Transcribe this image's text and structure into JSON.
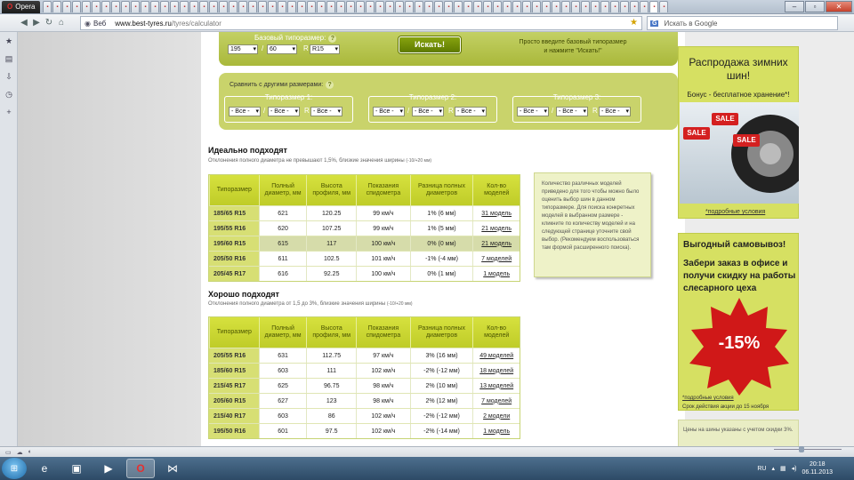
{
  "browser": {
    "menu_label": "Opera",
    "web_label": "Веб",
    "url_domain": "www.best-tyres.ru",
    "url_path": "/tyres/calculator",
    "search_placeholder": "Искать в Google",
    "search_engine": "G"
  },
  "form": {
    "base_size_label": "Базовый типоразмер:",
    "width": "195",
    "profile": "60",
    "r_label": "R",
    "radius": "R15",
    "search_button": "Искать!",
    "hint_line1": "Просто введите базовый типоразмер",
    "hint_line2": "и нажмите \"Искать!\"",
    "compare_label": "Сравнить с другими размерами:",
    "groups": [
      {
        "title": "Типоразмер 1:",
        "a": "- Все -",
        "b": "- Все -",
        "c": "- Все -"
      },
      {
        "title": "Типоразмер 2:",
        "a": "- Все -",
        "b": "- Все -",
        "c": "- Все -"
      },
      {
        "title": "Типоразмер 3:",
        "a": "- Все -",
        "b": "- Все -",
        "c": "- Все -"
      }
    ]
  },
  "ideal": {
    "title": "Идеально подходят",
    "subtitle": "Отклонения полного диаметра не превышают 1,5%, близкие значения ширины",
    "subtitle_small": "(-10/+20 мм)",
    "headers": [
      "Типоразмер",
      "Полный диаметр, мм",
      "Высота профиля, мм",
      "Показания спидометра",
      "Разница полных диаметров",
      "Кол-во моделей"
    ],
    "rows": [
      [
        "185/65 R15",
        "621",
        "120.25",
        "99 км/ч",
        "1% (6 мм)",
        "31 модель"
      ],
      [
        "195/55 R16",
        "620",
        "107.25",
        "99 км/ч",
        "1% (5 мм)",
        "21 модель"
      ],
      [
        "195/60 R15",
        "615",
        "117",
        "100 км/ч",
        "0% (0 мм)",
        "21 модель"
      ],
      [
        "205/50 R16",
        "611",
        "102.5",
        "101 км/ч",
        "-1% (-4 мм)",
        "7 моделей"
      ],
      [
        "205/45 R17",
        "616",
        "92.25",
        "100 км/ч",
        "0% (1 мм)",
        "1 модель"
      ]
    ]
  },
  "good": {
    "title": "Хорошо подходят",
    "subtitle": "Отклонения полного диаметра от 1,5 до 3%, близкие значения ширины",
    "subtitle_small": "(-10/+20 мм)",
    "headers": [
      "Типоразмер",
      "Полный диаметр, мм",
      "Высота профиля, мм",
      "Показания спидометра",
      "Разница полных диаметров",
      "Кол-во моделей"
    ],
    "rows": [
      [
        "205/55 R16",
        "631",
        "112.75",
        "97 км/ч",
        "3% (16 мм)",
        "49 моделей"
      ],
      [
        "185/60 R15",
        "603",
        "111",
        "102 км/ч",
        "-2% (-12 мм)",
        "18 моделей"
      ],
      [
        "215/45 R17",
        "625",
        "96.75",
        "98 км/ч",
        "2% (10 мм)",
        "13 моделей"
      ],
      [
        "205/60 R15",
        "627",
        "123",
        "98 км/ч",
        "2% (12 мм)",
        "7 моделей"
      ],
      [
        "215/40 R17",
        "603",
        "86",
        "102 км/ч",
        "-2% (-12 мм)",
        "2 модели"
      ],
      [
        "195/50 R16",
        "601",
        "97.5",
        "102 км/ч",
        "-2% (-14 мм)",
        "1 модель"
      ]
    ]
  },
  "note": "Количество различных моделей приведено для того чтобы можно было оценить выбор шин в данном типоразмере. Для поиска конкретных моделей в выбранном размере - кликните по количеству моделей и на следующей странице уточните свой выбор. (Рекомендуем воспользоваться там формой расширенного поиска).",
  "ads": {
    "ad1_title": "Распродажа зимних шин!",
    "ad1_sub": "Бонус - бесплатное хранение*!",
    "ad1_tag": "SALE",
    "ad1_link": "*подробные условия",
    "ad2_title": "Выгодный самовывоз!",
    "ad2_text": "Забери заказ в офисе и получи скидку на работы слесарного цеха",
    "ad2_discount": "-15%",
    "ad2_link": "*подробные условия",
    "ad2_date": "Срок действия акции до 15 ноября",
    "ad3_text": "Цены на шины указаны с учетом скидки 3%."
  },
  "taskbar": {
    "lang": "RU",
    "time": "20:18",
    "date": "06.11.2013"
  }
}
